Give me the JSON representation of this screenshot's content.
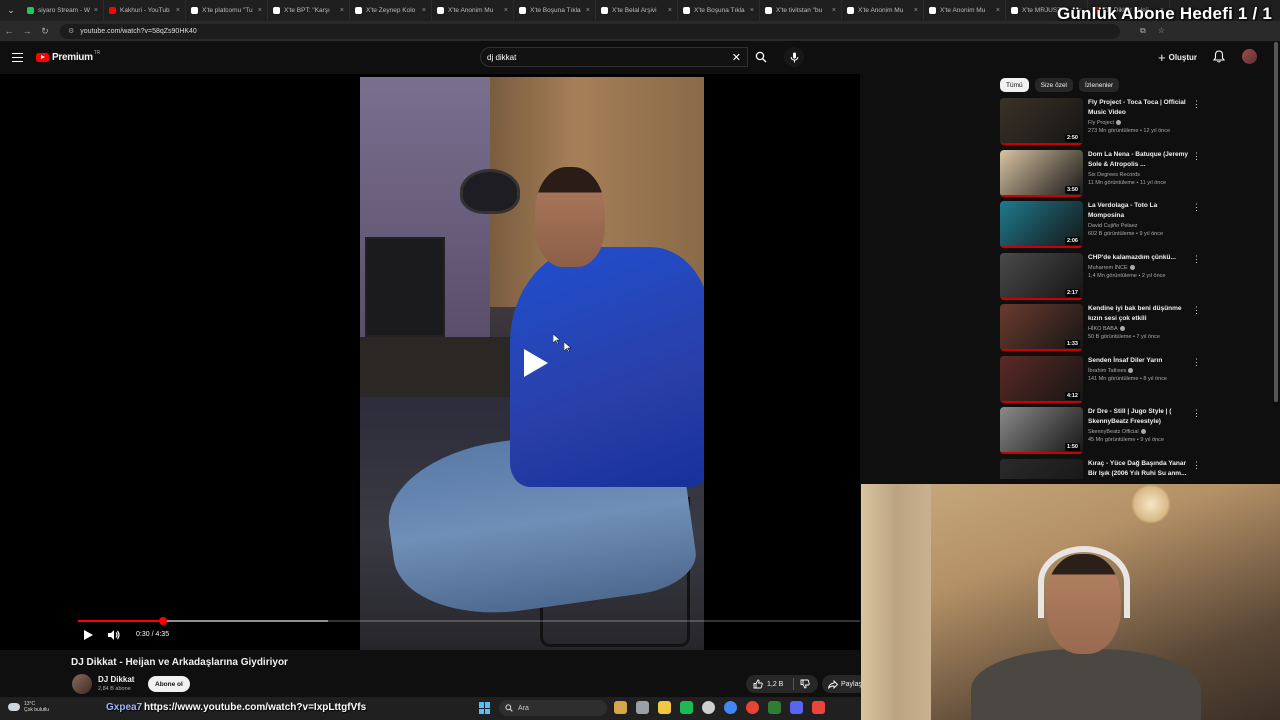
{
  "browser": {
    "tabs": [
      {
        "title": "siyaro Stream - W",
        "color": "#22c55e"
      },
      {
        "title": "Kakhuri - YouTub",
        "color": "#ff0000"
      },
      {
        "title": "X'te platcomu \"Tu",
        "color": "#ffffff"
      },
      {
        "title": "X'te BPT: \"Karşı",
        "color": "#ffffff"
      },
      {
        "title": "X'te Zeynep Kolo",
        "color": "#ffffff"
      },
      {
        "title": "X'te Anonim Mu",
        "color": "#ffffff"
      },
      {
        "title": "X'te Boşuna Tıkla",
        "color": "#ffffff"
      },
      {
        "title": "X'te Belal Arşivi",
        "color": "#ffffff"
      },
      {
        "title": "X'te Boşuna Tıkla",
        "color": "#ffffff"
      },
      {
        "title": "X'te tivitstan \"bu",
        "color": "#ffffff"
      },
      {
        "title": "X'te Anonim Mu",
        "color": "#ffffff"
      },
      {
        "title": "X'te Anonim Mu",
        "color": "#ffffff"
      },
      {
        "title": "X'te MRJUSTI",
        "color": "#ffffff"
      },
      {
        "title": "DJ Dikkat - Heij",
        "color": "#ff0000"
      }
    ],
    "url": "youtube.com/watch?v=58qZs90HK40",
    "overlay_title": "Günlük Abone Hedefi 1 / 1"
  },
  "header": {
    "logo_text": "Premium",
    "logo_region": "TR",
    "search_value": "dj dikkat",
    "create_label": "Oluştur"
  },
  "player": {
    "time": "0:30 / 4:35",
    "progress_fraction": 0.109,
    "buffer_fraction": 0.32
  },
  "video": {
    "title": "DJ Dikkat - Heijan ve Arkadaşlarına Giydiriyor",
    "channel": "DJ Dikkat",
    "subscribers": "2,84 B abone",
    "subscribe_label": "Abone ol",
    "likes": "1,2 B",
    "share_label": "Paylaş"
  },
  "sidebar": {
    "chips": [
      "Tümü",
      "Size özel",
      "İzlenenler"
    ],
    "recommendations": [
      {
        "title": "Fly Project - Toca Toca | Official Music Video",
        "channel": "Fly Project",
        "meta": "273 Mn görüntüleme • 12 yıl önce",
        "duration": "2:50",
        "thumb": "#3b3226",
        "verified": true
      },
      {
        "title": "Dom La Nena - Batuque (Jeremy Sole & Atropolis ...",
        "channel": "Six Degrees Records",
        "meta": "11 Mn görüntüleme • 11 yıl önce",
        "duration": "3:50",
        "thumb": "#d8c3a3",
        "verified": false
      },
      {
        "title": "La Verdolaga - Toto La Momposina",
        "channel": "David Cujiño Pelaez",
        "meta": "602 B görüntüleme • 9 yıl önce",
        "duration": "2:06",
        "thumb": "#1f7a8c",
        "verified": false
      },
      {
        "title": "CHP'de kalamazdım çünkü...",
        "channel": "Muharrem İNCE",
        "meta": "1,4 Mn görüntüleme • 2 yıl önce",
        "duration": "2:17",
        "thumb": "#4a4a4a",
        "verified": true
      },
      {
        "title": "Kendine iyi bak beni düşünme kızın sesi çok etkili",
        "channel": "HİKO BABA",
        "meta": "50 B görüntüleme • 7 yıl önce",
        "duration": "1:33",
        "thumb": "#6b3b2e",
        "verified": true
      },
      {
        "title": "Senden İnsaf Diler Yarın",
        "channel": "İbrahim Tatlıses",
        "meta": "141 Mn görüntüleme • 8 yıl önce",
        "duration": "4:12",
        "thumb": "#5b2a24",
        "verified": true
      },
      {
        "title": "Dr Dre - Still | Jugo Style | ( SkennyBeatz Freestyle)",
        "channel": "SkennyBeatz Official",
        "meta": "45 Mn görüntüleme • 9 yıl önce",
        "duration": "1:50",
        "thumb": "#8a8a8a",
        "verified": true
      },
      {
        "title": "Kıraç - Yüce Dağ Başında Yanar Bir Işık (2006 Yılı Ruhi Su anm...",
        "channel": "KIRAÇ",
        "meta": "",
        "duration": "",
        "thumb": "#2a2a2a",
        "verified": false
      }
    ]
  },
  "taskbar": {
    "temperature": "13°C",
    "weather": "Çok bulutlu",
    "search_label": "Ara",
    "chat_user": "Gxpea7",
    "chat_message": "https://www.youtube.com/watch?v=IxpLttgfVfs",
    "icon_colors": [
      "#d8a64a",
      "#9aa0a6",
      "#f2c744",
      "#1db954",
      "#cfcfcf",
      "#4285f4",
      "#ea4335",
      "#2e7d32",
      "#5865f2",
      "#e8453c"
    ]
  }
}
